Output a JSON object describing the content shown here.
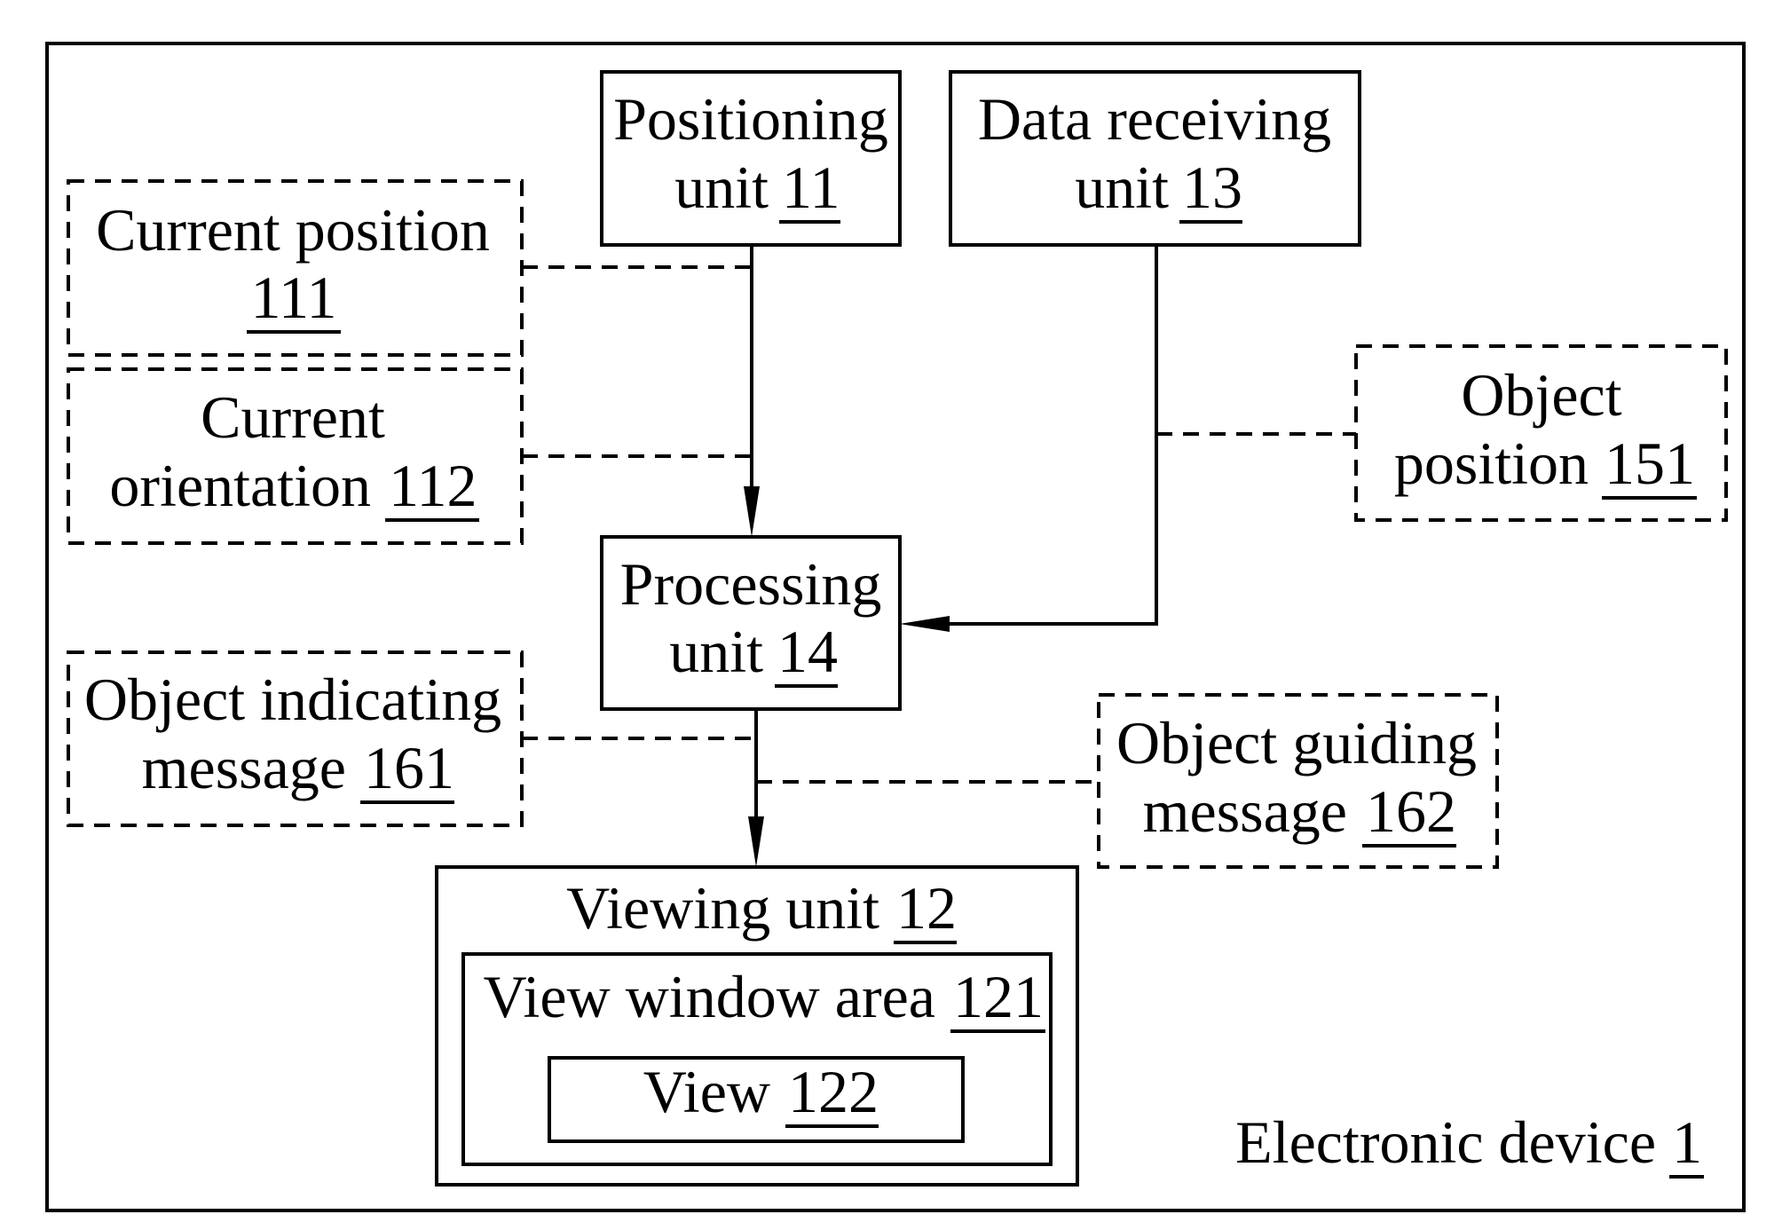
{
  "diagram": {
    "container": {
      "text": "Electronic device",
      "ref": "1"
    },
    "blocks": [
      {
        "id": "positioning",
        "lines": [
          "Positioning",
          "unit"
        ],
        "ref": "11",
        "style": "solid"
      },
      {
        "id": "data-receiving",
        "lines": [
          "Data receiving",
          "unit"
        ],
        "ref": "13",
        "style": "solid"
      },
      {
        "id": "current-position",
        "lines": [
          "Current position",
          ""
        ],
        "ref": "111",
        "style": "dashed"
      },
      {
        "id": "current-orientation",
        "lines": [
          "Current",
          "orientation"
        ],
        "ref": "112",
        "style": "dashed"
      },
      {
        "id": "object-position",
        "lines": [
          "Object",
          "position"
        ],
        "ref": "151",
        "style": "dashed"
      },
      {
        "id": "processing",
        "lines": [
          "Processing",
          "unit"
        ],
        "ref": "14",
        "style": "solid"
      },
      {
        "id": "object-indicating",
        "lines": [
          "Object indicating",
          "message"
        ],
        "ref": "161",
        "style": "dashed"
      },
      {
        "id": "object-guiding",
        "lines": [
          "Object guiding",
          "message"
        ],
        "ref": "162",
        "style": "dashed"
      },
      {
        "id": "viewing-unit",
        "lines": [
          "Viewing unit"
        ],
        "ref": "12",
        "style": "solid"
      },
      {
        "id": "view-window-area",
        "lines": [
          "View window area"
        ],
        "ref": "121",
        "style": "solid"
      },
      {
        "id": "view",
        "lines": [
          "View"
        ],
        "ref": "122",
        "style": "solid"
      }
    ],
    "connections": [
      {
        "from": "positioning",
        "to": "processing",
        "type": "arrow"
      },
      {
        "from": "data-receiving",
        "to": "processing",
        "type": "arrow"
      },
      {
        "from": "processing",
        "to": "viewing-unit",
        "type": "arrow"
      },
      {
        "from": "current-position",
        "to": "positioning-processing-link",
        "type": "dashed"
      },
      {
        "from": "current-orientation",
        "to": "positioning-processing-link",
        "type": "dashed"
      },
      {
        "from": "object-position",
        "to": "data-receiving-processing-link",
        "type": "dashed"
      },
      {
        "from": "object-indicating",
        "to": "processing-viewing-link",
        "type": "dashed"
      },
      {
        "from": "object-guiding",
        "to": "processing-viewing-link",
        "type": "dashed"
      }
    ]
  }
}
